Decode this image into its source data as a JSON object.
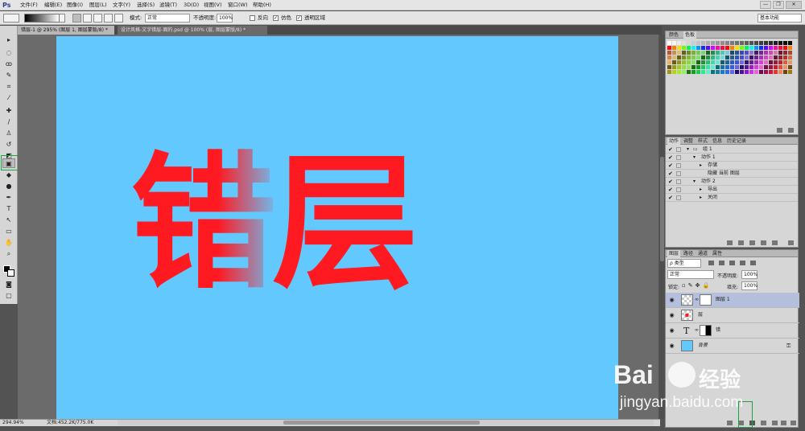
{
  "app": {
    "logo": "Ps"
  },
  "menu": [
    "文件(F)",
    "编辑(E)",
    "图像(I)",
    "图层(L)",
    "文字(Y)",
    "选择(S)",
    "滤镜(T)",
    "3D(D)",
    "视图(V)",
    "窗口(W)",
    "帮助(H)"
  ],
  "window_controls": {
    "minimize": "—",
    "restore": "❐",
    "close": "✕"
  },
  "options": {
    "mode_label": "模式:",
    "mode_value": "正常",
    "opacity_label": "不透明度:",
    "opacity_value": "100%",
    "reverse_label": "反向",
    "dither_label": "仿色",
    "transparency_label": "透明区域",
    "workspace": "基本功能"
  },
  "tabs": [
    {
      "label": "错层-1 @ 295% (图层 1, 图层蒙版/8) *"
    },
    {
      "label": "设计风格-文字错层-面的.psd @ 100% (层, 图层蒙版/8) *"
    }
  ],
  "canvas": {
    "text": "错层",
    "text_color": "#ff1a22",
    "bg_color": "#63c8fe"
  },
  "status": {
    "zoom": "294.94%",
    "doc": "文档:452.2K/775.0K"
  },
  "panels": {
    "swatches": {
      "tabs": [
        "颜色",
        "色板"
      ]
    },
    "actions": {
      "tabs": [
        "动作",
        "调整",
        "样式",
        "信息",
        "历史记录"
      ],
      "rows": [
        {
          "label": "组 1",
          "checked": "✔"
        },
        {
          "label": "动作 1",
          "checked": "✔"
        },
        {
          "label": "存储",
          "checked": "✔"
        },
        {
          "label": "隐藏 当前 图层",
          "checked": "✔"
        },
        {
          "label": "动作 2",
          "checked": "✔"
        },
        {
          "label": "导出",
          "checked": "✔"
        },
        {
          "label": "关闭",
          "checked": "✔"
        }
      ]
    },
    "layers": {
      "tabs": [
        "图层",
        "路径",
        "通道",
        "属性"
      ],
      "kind_label": "ρ 类型",
      "blend_value": "正常",
      "opacity_label": "不透明度:",
      "opacity_value": "100%",
      "lock_label": "锁定:",
      "fill_label": "填充:",
      "fill_value": "100%",
      "rows": [
        {
          "name": "图层 1"
        },
        {
          "name": "层"
        },
        {
          "name": "错"
        },
        {
          "name": "背景"
        }
      ]
    }
  },
  "watermark": {
    "brand_left": "Bai",
    "brand_right": "经验",
    "url": "jingyan.baidu.com"
  }
}
